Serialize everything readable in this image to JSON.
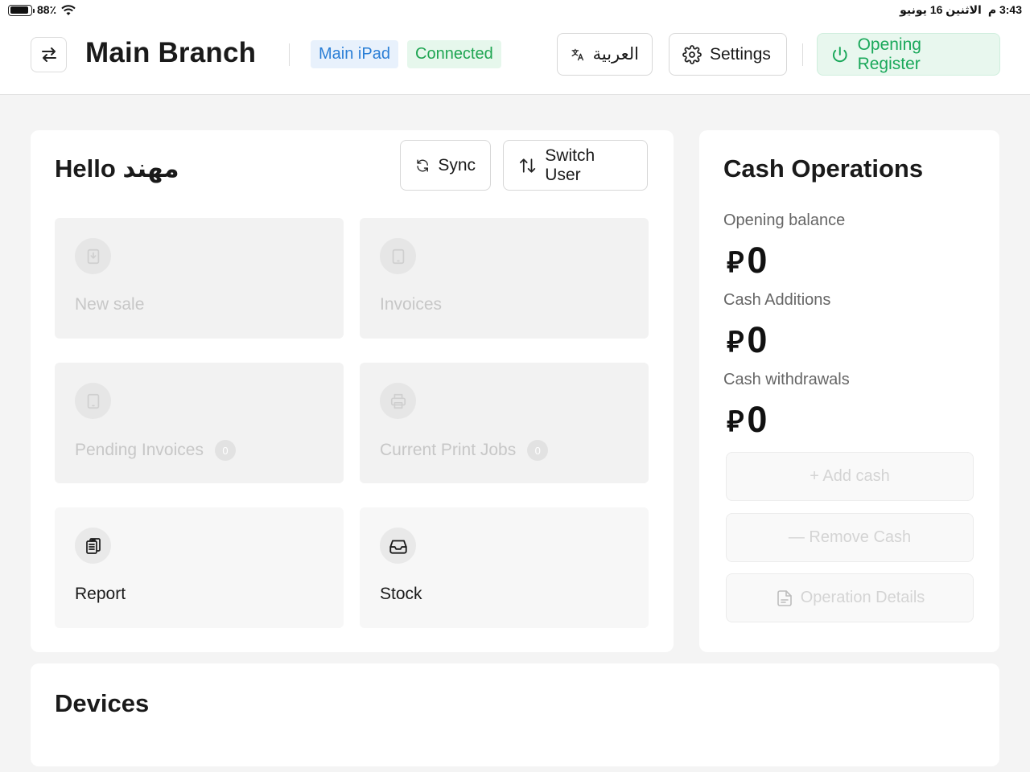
{
  "status_bar": {
    "battery": "88٪",
    "time": "3:43 م",
    "date": "الاثنين 16 يونيو"
  },
  "header": {
    "branch_title": "Main Branch",
    "device_tag": "Main iPad",
    "connection_tag": "Connected",
    "language_button": "العربية",
    "settings_button": "Settings",
    "register_button": "Opening Register",
    "colors": {
      "accent_green": "#1aa85a",
      "accent_blue": "#2a7ed6"
    }
  },
  "main": {
    "greeting": "Hello مهند",
    "sync_button": "Sync",
    "switch_user_button": "Switch User",
    "tiles": [
      {
        "label": "New sale",
        "icon": "download-tablet-icon",
        "enabled": false
      },
      {
        "label": "Invoices",
        "icon": "tablet-icon",
        "enabled": false
      },
      {
        "label": "Pending Invoices",
        "icon": "tablet-icon",
        "badge": "0",
        "enabled": false
      },
      {
        "label": "Current Print Jobs",
        "icon": "printer-icon",
        "badge": "0",
        "enabled": false
      },
      {
        "label": "Report",
        "icon": "clipboard-icon",
        "enabled": true
      },
      {
        "label": "Stock",
        "icon": "inbox-icon",
        "enabled": true
      }
    ]
  },
  "cash": {
    "title": "Cash Operations",
    "currency_symbol": "⃁",
    "opening_balance_label": "Opening balance",
    "opening_balance": "0",
    "additions_label": "Cash Additions",
    "additions": "0",
    "withdrawals_label": "Cash withdrawals",
    "withdrawals": "0",
    "add_cash_button": "+ Add cash",
    "remove_cash_button": "— Remove Cash",
    "details_button": "Operation Details"
  },
  "devices": {
    "title": "Devices"
  }
}
